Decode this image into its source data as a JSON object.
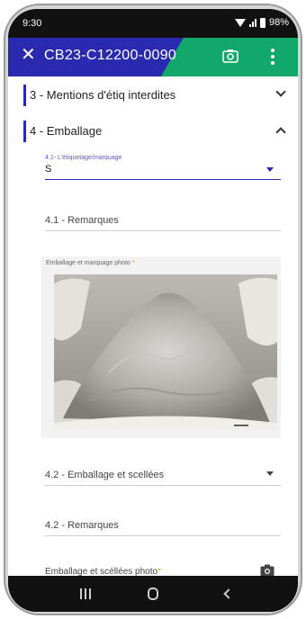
{
  "status": {
    "time": "9:30",
    "battery": "98%"
  },
  "appbar": {
    "close_icon": "close-icon",
    "title": "CB23-C12200-0090",
    "camera_icon": "camera-icon",
    "more_icon": "more-vert-icon",
    "colors": {
      "primary": "#2a2ab0",
      "accent": "#13a86b"
    }
  },
  "sections": [
    {
      "label": "3 - Mentions d'étiq interdites",
      "expanded": false
    },
    {
      "label": "4 - Emballage",
      "expanded": true
    }
  ],
  "form": {
    "etiquetage": {
      "label": "4.1- L'étiquetage/marquage",
      "value": "S"
    },
    "remarques_41": {
      "placeholder": "4.1 - Remarques"
    },
    "photo1": {
      "label": "Emballage et marquage photo",
      "required_mark": "*"
    },
    "emballage_scellees": {
      "placeholder": "4.2 - Emballage et scellées"
    },
    "remarques_42": {
      "placeholder": "4.2 - Remarques"
    },
    "photo2": {
      "label": "Emballage et scéllées photo",
      "required_mark": "*"
    }
  },
  "navbar": {
    "recents_icon": "recents-icon",
    "home_icon": "home-icon",
    "back_icon": "back-icon"
  }
}
